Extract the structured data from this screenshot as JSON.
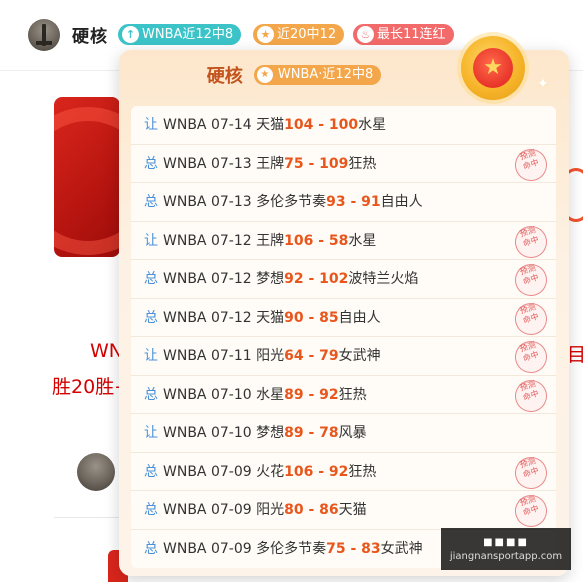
{
  "header": {
    "username": "硬核",
    "tags": [
      {
        "label": "WNBA近12中8",
        "icon": "arrow-up-icon",
        "color": "#3cc3c8"
      },
      {
        "label": "近20中12",
        "icon": "star-icon",
        "color": "#f3a64a"
      },
      {
        "label": "最长11连红",
        "icon": "flame-icon",
        "color": "#f26a6a"
      }
    ]
  },
  "background": {
    "title_line1": "WN",
    "title_line2": "胜20胜+",
    "right_fragment": "目"
  },
  "popup": {
    "name": "硬核",
    "tag_label": "WNBA·近12中8",
    "tag_icon": "star-icon",
    "stamp_text": [
      "预测",
      "命中"
    ],
    "rows": [
      {
        "kind": "让",
        "league": "WNBA",
        "date": "07-14",
        "home": "天猫",
        "score_home": "104",
        "score_away": "100",
        "away": "水星",
        "hit": false
      },
      {
        "kind": "总",
        "league": "WNBA",
        "date": "07-13",
        "home": "王牌",
        "score_home": "75",
        "score_away": "109",
        "away": "狂热",
        "hit": true
      },
      {
        "kind": "总",
        "league": "WNBA",
        "date": "07-13",
        "home": "多伦多节奏",
        "score_home": "93",
        "score_away": "91",
        "away": "自由人",
        "hit": false
      },
      {
        "kind": "让",
        "league": "WNBA",
        "date": "07-12",
        "home": "王牌",
        "score_home": "106",
        "score_away": "58",
        "away": "水星",
        "hit": true
      },
      {
        "kind": "总",
        "league": "WNBA",
        "date": "07-12",
        "home": "梦想",
        "score_home": "92",
        "score_away": "102",
        "away": "波特兰火焰",
        "hit": true
      },
      {
        "kind": "总",
        "league": "WNBA",
        "date": "07-12",
        "home": "天猫",
        "score_home": "90",
        "score_away": "85",
        "away": "自由人",
        "hit": true
      },
      {
        "kind": "让",
        "league": "WNBA",
        "date": "07-11",
        "home": "阳光",
        "score_home": "64",
        "score_away": "79",
        "away": "女武神",
        "hit": true
      },
      {
        "kind": "总",
        "league": "WNBA",
        "date": "07-10",
        "home": "水星",
        "score_home": "89",
        "score_away": "92",
        "away": "狂热",
        "hit": true
      },
      {
        "kind": "让",
        "league": "WNBA",
        "date": "07-10",
        "home": "梦想",
        "score_home": "89",
        "score_away": "78",
        "away": "风暴",
        "hit": false
      },
      {
        "kind": "总",
        "league": "WNBA",
        "date": "07-09",
        "home": "火花",
        "score_home": "106",
        "score_away": "92",
        "away": "狂热",
        "hit": true
      },
      {
        "kind": "总",
        "league": "WNBA",
        "date": "07-09",
        "home": "阳光",
        "score_home": "80",
        "score_away": "86",
        "away": "天猫",
        "hit": true
      },
      {
        "kind": "总",
        "league": "WNBA",
        "date": "07-09",
        "home": "多伦多节奏",
        "score_home": "75",
        "score_away": "83",
        "away": "女武神",
        "hit": false
      }
    ]
  },
  "watermark": {
    "line1": "■■■■",
    "line2": "jiangnansportapp.com"
  },
  "colors": {
    "accent_score": "#e8561c",
    "kind_blue": "#4a90d9",
    "popup_title": "#c2531d"
  }
}
